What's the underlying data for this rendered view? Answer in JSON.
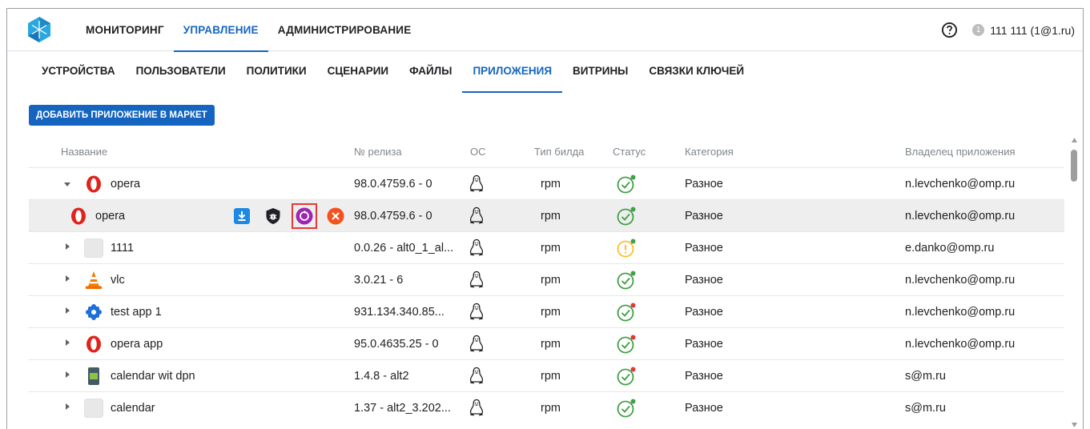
{
  "top_nav": {
    "items": [
      {
        "label": "МОНИТОРИНГ",
        "active": false
      },
      {
        "label": "УПРАВЛЕНИЕ",
        "active": true
      },
      {
        "label": "АДМИНИСТРИРОВАНИЕ",
        "active": false
      }
    ],
    "help_icon": "question-circle-icon",
    "user_badge": "1",
    "user_name": "111 111 (1@1.ru)"
  },
  "sub_nav": {
    "items": [
      {
        "label": "УСТРОЙСТВА",
        "active": false
      },
      {
        "label": "ПОЛЬЗОВАТЕЛИ",
        "active": false
      },
      {
        "label": "ПОЛИТИКИ",
        "active": false
      },
      {
        "label": "СЦЕНАРИИ",
        "active": false
      },
      {
        "label": "ФАЙЛЫ",
        "active": false
      },
      {
        "label": "ПРИЛОЖЕНИЯ",
        "active": true
      },
      {
        "label": "ВИТРИНЫ",
        "active": false
      },
      {
        "label": "СВЯЗКИ КЛЮЧЕЙ",
        "active": false
      }
    ]
  },
  "add_button": "ДОБАВИТЬ ПРИЛОЖЕНИЕ В МАРКЕТ",
  "table": {
    "columns": [
      "Название",
      "№ релиза",
      "ОС",
      "Тип билда",
      "Статус",
      "Категория",
      "Владелец приложения"
    ],
    "rows": [
      {
        "name": "opera",
        "release": "98.0.4759.6 - 0",
        "build": "rpm",
        "category": "Разное",
        "owner": "n.levchenko@omp.ru",
        "icon": "opera-icon",
        "status": "ok",
        "dot": "green",
        "expanded": true
      },
      {
        "name": "opera",
        "release": "98.0.4759.6 - 0",
        "build": "rpm",
        "category": "Разное",
        "owner": "n.levchenko@omp.ru",
        "icon": "opera-icon",
        "status": "ok",
        "dot": "green",
        "child": true
      },
      {
        "name": "1111",
        "release": "0.0.26 - alt0_1_al...",
        "build": "rpm",
        "category": "Разное",
        "owner": "e.danko@omp.ru",
        "icon": "blank-app-icon",
        "status": "warning",
        "dot": "green"
      },
      {
        "name": "vlc",
        "release": "3.0.21 - 6",
        "build": "rpm",
        "category": "Разное",
        "owner": "n.levchenko@omp.ru",
        "icon": "vlc-cone-icon",
        "status": "ok",
        "dot": "green"
      },
      {
        "name": "test app 1",
        "release": "931.134.340.85...",
        "build": "rpm",
        "category": "Разное",
        "owner": "n.levchenko@omp.ru",
        "icon": "puzzle-app-icon",
        "status": "ok",
        "dot": "red"
      },
      {
        "name": "opera app",
        "release": "95.0.4635.25 - 0",
        "build": "rpm",
        "category": "Разное",
        "owner": "n.levchenko@omp.ru",
        "icon": "opera-icon",
        "status": "ok",
        "dot": "red"
      },
      {
        "name": "calendar wit dpn",
        "release": "1.4.8 - alt2",
        "build": "rpm",
        "category": "Разное",
        "owner": "s@m.ru",
        "icon": "calendar-app-icon",
        "status": "ok",
        "dot": "red"
      },
      {
        "name": "calendar",
        "release": "1.37 - alt2_3.202...",
        "build": "rpm",
        "category": "Разное",
        "owner": "s@m.ru",
        "icon": "blank-app-icon",
        "status": "ok",
        "dot": "green"
      }
    ],
    "row_actions": [
      "download-icon",
      "shield-bug-icon",
      "sync-icon",
      "remove-icon"
    ]
  },
  "colors": {
    "accent": "#1565c0",
    "ok": "#43a047",
    "warning": "#fbc02d",
    "danger": "#e53935",
    "purple": "#9c27b0",
    "orange": "#f4511e"
  }
}
